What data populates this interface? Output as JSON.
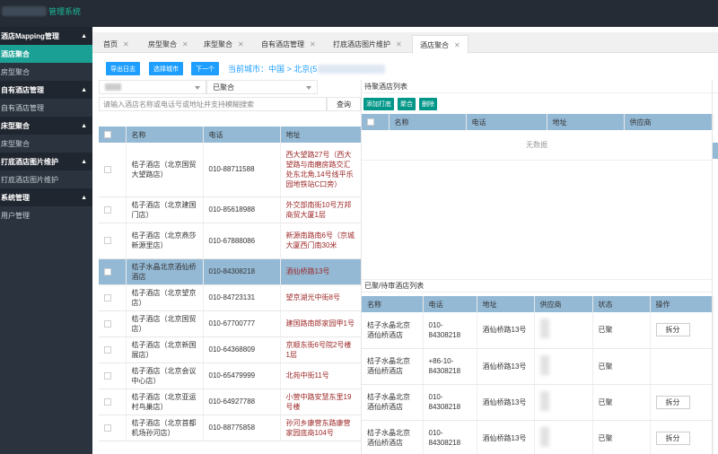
{
  "app": {
    "title": "管理系统"
  },
  "sidebar": {
    "groups": [
      {
        "label": "酒店Mapping管理",
        "items": [
          "酒店聚合",
          "房型聚合"
        ]
      },
      {
        "label": "自有酒店管理",
        "items": [
          "自有酒店管理"
        ]
      },
      {
        "label": "床型聚合",
        "items": [
          "床型聚合"
        ]
      },
      {
        "label": "打底酒店图片维护",
        "items": [
          "打底酒店图片维护"
        ]
      },
      {
        "label": "系统管理",
        "items": [
          "用户管理"
        ]
      }
    ]
  },
  "tabs": [
    {
      "label": "首页"
    },
    {
      "label": "房型聚合"
    },
    {
      "label": "床型聚合"
    },
    {
      "label": "自有酒店管理"
    },
    {
      "label": "打底酒店图片维护"
    },
    {
      "label": "酒店聚合",
      "active": true
    }
  ],
  "toolbar": {
    "export_label": "导出日志",
    "select_city_label": "选择城市",
    "next_label": "下一个",
    "current_city": "当前城市：中国 > 北京(5"
  },
  "left": {
    "status_select": "已聚合",
    "search_placeholder": "请输入酒店名称或电话号或地址并支持模糊搜索",
    "search_button": "查询",
    "columns": [
      "名称",
      "电话",
      "地址"
    ],
    "rows": [
      {
        "name": "桔子酒店（北京国贸大望路店）",
        "phone": "010-88711588",
        "address": "西大望路27号（西大望路与南磨房路交汇处东北角,14号线平乐园地铁站C口旁）"
      },
      {
        "name": "桔子酒店（北京建国门店）",
        "phone": "010-85618988",
        "address": "外交部南街10号万邦商贸大厦1层"
      },
      {
        "name": "桔子酒店（北京燕莎新源里店）",
        "phone": "010-67888086",
        "address": "新源南路南6号（京城大厦西门南30米"
      },
      {
        "name": "桔子水晶北京酒仙桥酒店",
        "phone": "010-84308218",
        "address": "酒仙桥路13号",
        "selected": true
      },
      {
        "name": "桔子酒店（北京望京店）",
        "phone": "010-84723131",
        "address": "望京湖光中街8号"
      },
      {
        "name": "桔子酒店（北京国贸店）",
        "phone": "010-67700777",
        "address": "建国路南郎家园甲1号"
      },
      {
        "name": "桔子酒店（北京新国展店）",
        "phone": "010-64368809",
        "address": "京顺东街6号院2号楼1层"
      },
      {
        "name": "桔子酒店（北京会议中心店）",
        "phone": "010-65479999",
        "address": "北苑中街11号"
      },
      {
        "name": "桔子酒店（北京亚运村鸟巢店）",
        "phone": "010-64927788",
        "address": "小营中路安慧东里19号楼"
      },
      {
        "name": "桔子酒店（北京首都机场孙河店）",
        "phone": "010-88775858",
        "address": "孙河乡康营东路康营家园底商104号"
      }
    ]
  },
  "pending": {
    "title": "待聚酒店列表",
    "add_label": "添加打底",
    "merge_label": "聚合",
    "delete_label": "删除",
    "columns": [
      "名称",
      "电话",
      "地址",
      "供应商"
    ],
    "empty_text": "无数据"
  },
  "merged": {
    "title": "已聚/待审酒店列表",
    "columns": [
      "名称",
      "电话",
      "地址",
      "供应商",
      "状态",
      "操作"
    ],
    "split_label": "拆分",
    "rows": [
      {
        "name": "桔子水晶北京酒仙桥酒店",
        "phone": "010-84308218",
        "address": "酒仙桥路13号",
        "status": "已聚",
        "split": true
      },
      {
        "name": "桔子水晶北京酒仙桥酒店",
        "phone": "+86-10-84308218",
        "address": "酒仙桥路13号",
        "status": "已聚",
        "split": false
      },
      {
        "name": "桔子水晶北京酒仙桥酒店",
        "phone": "010-84308218",
        "address": "酒仙桥路13号",
        "status": "已聚",
        "split": true
      },
      {
        "name": "桔子水晶北京酒仙桥酒店",
        "phone": "010-84308218",
        "address": "酒仙桥路13号",
        "status": "已聚",
        "split": true
      }
    ]
  }
}
